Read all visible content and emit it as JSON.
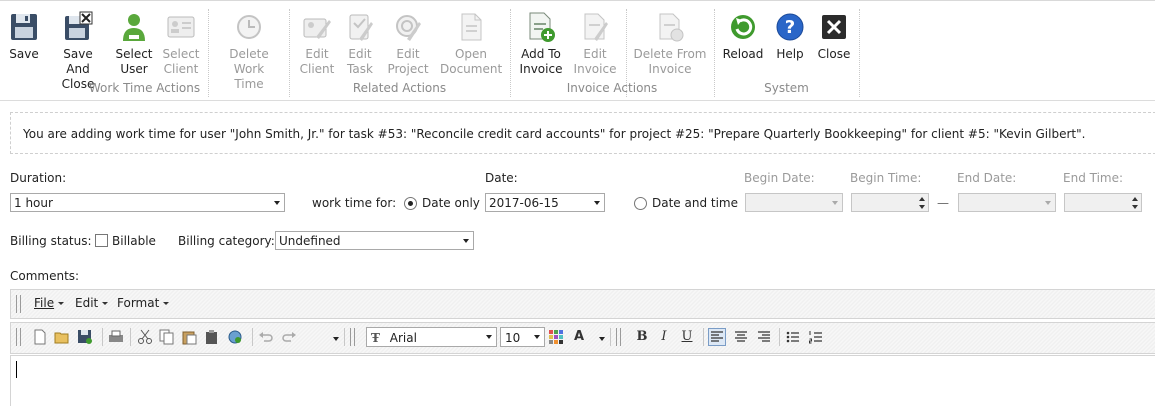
{
  "ribbon": {
    "buttons": [
      {
        "id": "save",
        "label": "Save",
        "icon": "floppy-disk-icon",
        "enabled": true
      },
      {
        "id": "save_close",
        "label": "Save And\nClose",
        "icon": "save-close-icon",
        "enabled": true
      },
      {
        "id": "select_user",
        "label": "Select\nUser",
        "icon": "user-icon",
        "enabled": true
      },
      {
        "id": "select_client",
        "label": "Select\nClient",
        "icon": "client-card-icon",
        "enabled": false
      },
      {
        "id": "delete_work_time",
        "label": "Delete\nWork Time",
        "icon": "delete-clock-icon",
        "enabled": false
      },
      {
        "id": "edit_client",
        "label": "Edit\nClient",
        "icon": "edit-client-icon",
        "enabled": false
      },
      {
        "id": "edit_task",
        "label": "Edit\nTask",
        "icon": "edit-task-icon",
        "enabled": false
      },
      {
        "id": "edit_project",
        "label": "Edit\nProject",
        "icon": "edit-project-icon",
        "enabled": false
      },
      {
        "id": "open_document",
        "label": "Open\nDocument",
        "icon": "document-icon",
        "enabled": false
      },
      {
        "id": "add_to_invoice",
        "label": "Add To\nInvoice",
        "icon": "add-invoice-icon",
        "enabled": true
      },
      {
        "id": "edit_invoice",
        "label": "Edit\nInvoice",
        "icon": "edit-invoice-icon",
        "enabled": false
      },
      {
        "id": "delete_from_invoice",
        "label": "Delete From\nInvoice",
        "icon": "delete-invoice-icon",
        "enabled": false
      },
      {
        "id": "reload",
        "label": "Reload",
        "icon": "reload-icon",
        "enabled": true
      },
      {
        "id": "help",
        "label": "Help",
        "icon": "help-icon",
        "enabled": true
      },
      {
        "id": "close",
        "label": "Close",
        "icon": "close-icon",
        "enabled": true
      }
    ],
    "groups": [
      "Work Time Actions",
      "Related Actions",
      "Invoice Actions",
      "System"
    ]
  },
  "banner": {
    "text": "You are adding work time for user \"John Smith, Jr.\" for task #53: \"Reconcile credit card accounts\" for project #25: \"Prepare Quarterly Bookkeeping\" for client #5: \"Kevin Gilbert\"."
  },
  "form": {
    "duration_label": "Duration:",
    "duration_value": "1 hour",
    "work_time_for_label": "work time for:",
    "date_only_label": "Date only",
    "date_label": "Date:",
    "date_value": "2017-06-15",
    "date_and_time_label": "Date and time",
    "begin_date_label": "Begin Date:",
    "begin_time_label": "Begin Time:",
    "end_date_label": "End Date:",
    "end_time_label": "End Time:",
    "range_dash": "—",
    "billing_status_label": "Billing status:",
    "billable_label": "Billable",
    "billable_checked": false,
    "billing_category_label": "Billing category:",
    "billing_category_value": "Undefined",
    "comments_label": "Comments:",
    "mode": "date_only"
  },
  "editor": {
    "menus": [
      "File",
      "Edit",
      "Format"
    ],
    "font_name": "Arial",
    "font_size": "10",
    "font_icon_glyph": "Ŧ"
  },
  "colors": {
    "disabled_text": "#9a9a9a",
    "group_label": "#8a8a8a",
    "help_blue": "#2a66c8",
    "reload_green": "#3f9a2e"
  }
}
